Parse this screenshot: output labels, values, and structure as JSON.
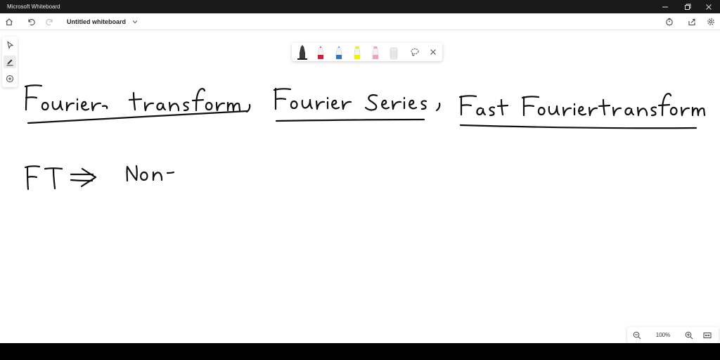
{
  "window": {
    "app_title": "Microsoft Whiteboard",
    "minimize_icon": "minimize-icon",
    "restore_icon": "restore-icon",
    "close_icon": "close-icon"
  },
  "appbar": {
    "home_icon": "home-icon",
    "undo_icon": "undo-icon",
    "redo_icon": "redo-icon",
    "board_title": "Untitled whiteboard",
    "title_menu_icon": "chevron-down-icon",
    "timer_icon": "timer-icon",
    "share_icon": "share-icon",
    "settings_icon": "gear-icon"
  },
  "left_toolbar": {
    "tools": [
      "select-icon",
      "pen-icon",
      "add-icon"
    ],
    "active_tool": "pen-icon"
  },
  "ink_toolbar": {
    "pens": [
      {
        "name": "black-pen",
        "color": "#1a1a1a"
      },
      {
        "name": "red-pen",
        "color": "#d0203f"
      },
      {
        "name": "blue-pen",
        "color": "#2f75c4"
      },
      {
        "name": "yellow-highlighter",
        "color": "#f0f000"
      },
      {
        "name": "pink-highlighter",
        "color": "#f2a3b4"
      },
      {
        "name": "eraser",
        "color": "#dcdcdc"
      }
    ],
    "selected_pen": "black-pen",
    "lasso_icon": "lasso-icon",
    "close_icon": "close-icon"
  },
  "canvas": {
    "handwriting": [
      "Fourier transform,",
      "Fourier Series,",
      "Fast Fourier transform",
      "FT -> Non-"
    ]
  },
  "zoom": {
    "zoom_out_icon": "zoom-out-icon",
    "level": "100%",
    "zoom_in_icon": "zoom-in-icon",
    "fit_icon": "fit-screen-icon"
  }
}
